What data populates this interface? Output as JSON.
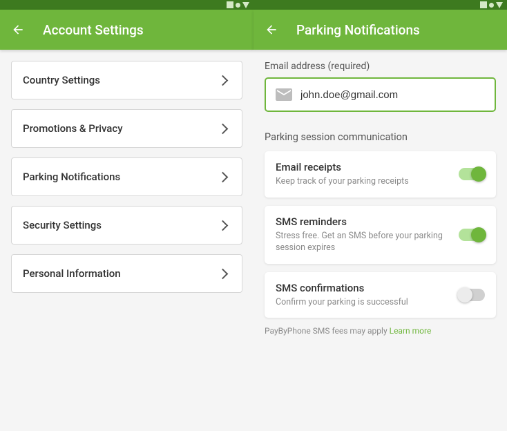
{
  "left": {
    "header_title": "Account Settings",
    "items": [
      {
        "label": "Country Settings"
      },
      {
        "label": "Promotions & Privacy"
      },
      {
        "label": "Parking Notifications"
      },
      {
        "label": "Security Settings"
      },
      {
        "label": "Personal Information"
      }
    ]
  },
  "right": {
    "header_title": "Parking Notifications",
    "email_label": "Email address (required)",
    "email_value": "john.doe@gmail.com",
    "section_label": "Parking session communication",
    "toggles": [
      {
        "title": "Email receipts",
        "subtitle": "Keep track of your parking receipts",
        "on": true
      },
      {
        "title": "SMS reminders",
        "subtitle": "Stress free. Get an SMS before your parking session expires",
        "on": true
      },
      {
        "title": "SMS confirmations",
        "subtitle": "Confirm your parking is successful",
        "on": false
      }
    ],
    "footer_note": "PayByPhone SMS fees may apply",
    "learn_more": "Learn more"
  }
}
